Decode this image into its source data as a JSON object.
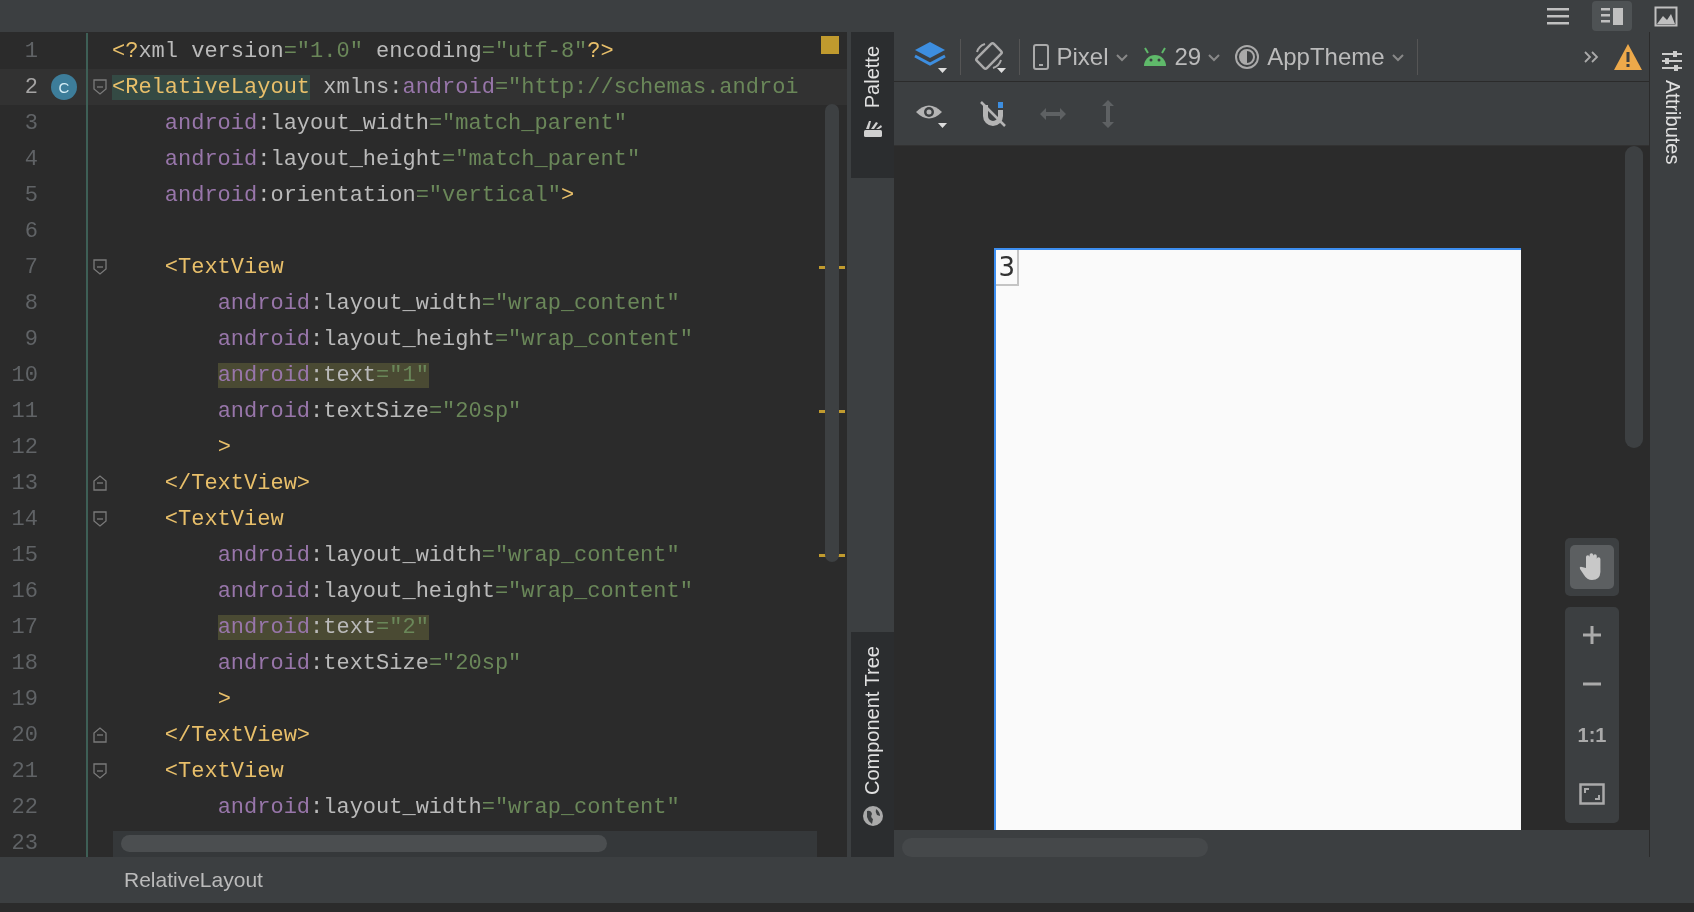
{
  "top_bar": {
    "view_modes": [
      {
        "kind": "code",
        "selected": false
      },
      {
        "kind": "split",
        "selected": true
      },
      {
        "kind": "design",
        "selected": false
      }
    ]
  },
  "editor": {
    "lines": [
      {
        "number": "1",
        "current": false,
        "tokens": [
          {
            "kind": "tag",
            "text": "<?"
          },
          {
            "kind": "attr",
            "text": "xml version"
          },
          {
            "kind": "value",
            "text": "=\"1.0\""
          },
          {
            "kind": "attr",
            "text": " encoding"
          },
          {
            "kind": "value",
            "text": "=\"utf-8\""
          },
          {
            "kind": "tag",
            "text": "?>"
          }
        ]
      },
      {
        "number": "2",
        "current": true,
        "badge": "C",
        "fold_open": true,
        "tokens": [
          {
            "kind": "tag",
            "text": "<RelativeLayout",
            "caret_match": true
          },
          {
            "kind": "attr",
            "text": " xmlns:"
          },
          {
            "kind": "ns",
            "text": "android"
          },
          {
            "kind": "value",
            "text": "=\"http://schemas.androi"
          }
        ]
      },
      {
        "number": "3",
        "current": false,
        "tokens": [
          {
            "kind": "ns",
            "text": "    android"
          },
          {
            "kind": "attr",
            "text": ":layout_width"
          },
          {
            "kind": "value",
            "text": "=\"match_parent\""
          }
        ]
      },
      {
        "number": "4",
        "current": false,
        "tokens": [
          {
            "kind": "ns",
            "text": "    android"
          },
          {
            "kind": "attr",
            "text": ":layout_height"
          },
          {
            "kind": "value",
            "text": "=\"match_parent\""
          }
        ]
      },
      {
        "number": "5",
        "current": false,
        "tokens": [
          {
            "kind": "ns",
            "text": "    android"
          },
          {
            "kind": "attr",
            "text": ":orientation"
          },
          {
            "kind": "value",
            "text": "=\"vertical\""
          },
          {
            "kind": "tag",
            "text": ">"
          }
        ]
      },
      {
        "number": "6",
        "current": false
      },
      {
        "number": "7",
        "current": false,
        "fold_open": true,
        "warning": true,
        "tokens": [
          {
            "kind": "tag",
            "text": "    <TextView"
          }
        ]
      },
      {
        "number": "8",
        "current": false,
        "tokens": [
          {
            "kind": "ns",
            "text": "        android"
          },
          {
            "kind": "attr",
            "text": ":layout_width"
          },
          {
            "kind": "value",
            "text": "=\"wrap_content\""
          }
        ]
      },
      {
        "number": "9",
        "current": false,
        "tokens": [
          {
            "kind": "ns",
            "text": "        android"
          },
          {
            "kind": "attr",
            "text": ":layout_height"
          },
          {
            "kind": "value",
            "text": "=\"wrap_content\""
          }
        ]
      },
      {
        "number": "10",
        "current": false,
        "tokens": [
          {
            "kind": "ns",
            "text": "        android",
            "matched": true
          },
          {
            "kind": "attr",
            "text": ":text",
            "matched": true
          },
          {
            "kind": "value",
            "text": "=\"1\"",
            "matched": true
          }
        ]
      },
      {
        "number": "11",
        "current": false,
        "warning": true,
        "tokens": [
          {
            "kind": "ns",
            "text": "        android"
          },
          {
            "kind": "attr",
            "text": ":textSize"
          },
          {
            "kind": "value",
            "text": "=\"20sp\""
          }
        ]
      },
      {
        "number": "12",
        "current": false,
        "tokens": [
          {
            "kind": "tag",
            "text": "        >"
          }
        ]
      },
      {
        "number": "13",
        "current": false,
        "fold_close": true,
        "tokens": [
          {
            "kind": "tag",
            "text": "    </TextView>"
          }
        ]
      },
      {
        "number": "14",
        "current": false,
        "fold_open": true,
        "tokens": [
          {
            "kind": "tag",
            "text": "    <TextView"
          }
        ]
      },
      {
        "number": "15",
        "current": false,
        "warning": true,
        "tokens": [
          {
            "kind": "ns",
            "text": "        android"
          },
          {
            "kind": "attr",
            "text": ":layout_width"
          },
          {
            "kind": "value",
            "text": "=\"wrap_content\""
          }
        ]
      },
      {
        "number": "16",
        "current": false,
        "tokens": [
          {
            "kind": "ns",
            "text": "        android"
          },
          {
            "kind": "attr",
            "text": ":layout_height"
          },
          {
            "kind": "value",
            "text": "=\"wrap_content\""
          }
        ]
      },
      {
        "number": "17",
        "current": false,
        "tokens": [
          {
            "kind": "ns",
            "text": "        android",
            "matched": true
          },
          {
            "kind": "attr",
            "text": ":text",
            "matched": true
          },
          {
            "kind": "value",
            "text": "=\"2\"",
            "matched": true
          }
        ]
      },
      {
        "number": "18",
        "current": false,
        "tokens": [
          {
            "kind": "ns",
            "text": "        android"
          },
          {
            "kind": "attr",
            "text": ":textSize"
          },
          {
            "kind": "value",
            "text": "=\"20sp\""
          }
        ]
      },
      {
        "number": "19",
        "current": false,
        "tokens": [
          {
            "kind": "tag",
            "text": "        >"
          }
        ]
      },
      {
        "number": "20",
        "current": false,
        "fold_close": true,
        "tokens": [
          {
            "kind": "tag",
            "text": "    </TextView>"
          }
        ]
      },
      {
        "number": "21",
        "current": false,
        "fold_open": true,
        "tokens": [
          {
            "kind": "tag",
            "text": "    <TextView"
          }
        ]
      },
      {
        "number": "22",
        "current": false,
        "tokens": [
          {
            "kind": "ns",
            "text": "        android"
          },
          {
            "kind": "attr",
            "text": ":layout_width"
          },
          {
            "kind": "value",
            "text": "=\"wrap_content\""
          }
        ]
      },
      {
        "number": "23",
        "current": false
      }
    ]
  },
  "left_tabs": [
    {
      "kind": "palette",
      "label": "Palette"
    },
    {
      "kind": "tree",
      "label": "Component Tree"
    }
  ],
  "toolbar": {
    "device": "Pixel",
    "api": "29",
    "theme": "AppTheme",
    "tools": [
      {
        "kind": "eye",
        "disabled": false
      },
      {
        "kind": "magnet",
        "disabled": false
      },
      {
        "kind": "h-arrows",
        "disabled": true
      },
      {
        "kind": "v-arrows",
        "disabled": true
      }
    ]
  },
  "preview": {
    "texts": [
      "3"
    ]
  },
  "zoom_controls": {
    "pan_selected": true,
    "actual_size": "1:1"
  },
  "right_tabs": [
    {
      "label": "Attributes"
    }
  ],
  "breadcrumb": "RelativeLayout"
}
